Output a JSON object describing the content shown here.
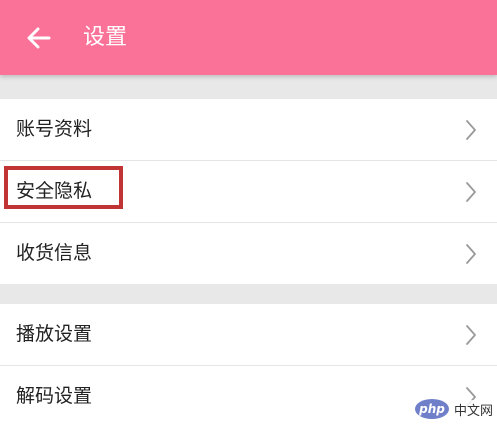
{
  "header": {
    "title": "设置",
    "back_icon": "arrow-left-icon",
    "background_color": "#fb7299"
  },
  "groups": [
    {
      "items": [
        {
          "label": "账号资料",
          "icon": "chevron-right-icon"
        },
        {
          "label": "安全隐私",
          "icon": "chevron-right-icon",
          "highlighted": true
        },
        {
          "label": "收货信息",
          "icon": "chevron-right-icon"
        }
      ]
    },
    {
      "items": [
        {
          "label": "播放设置",
          "icon": "chevron-right-icon"
        },
        {
          "label": "解码设置",
          "icon": "chevron-right-icon"
        }
      ]
    }
  ],
  "annotation": {
    "highlight_color": "#c13434"
  },
  "watermark": {
    "logo_text": "php",
    "text": "中文网"
  }
}
